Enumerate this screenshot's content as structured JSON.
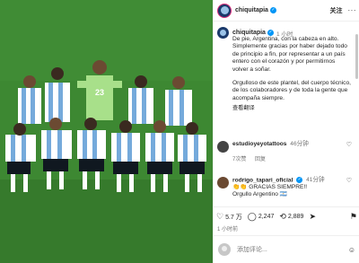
{
  "post": {
    "username": "chiquitapia",
    "follow_label": "关注",
    "more_label": "···",
    "time": "1 小时",
    "caption_p1": "De pie, Argentina, con la cabeza en alto. Simplemente gracias por haber dejado todo de principio a fin, por representar a un país entero con el corazón y por permitirnos volver a soñar.",
    "caption_p2": "Orgulloso de este plantel, del cuerpo técnico, de los colaboradores y de toda la gente que acompaña siempre.",
    "translate_label": "查看翻译",
    "posted_time": "1 小时前"
  },
  "comments": [
    {
      "username": "estudioyeyotattoos",
      "time": "46分钟",
      "text": "",
      "meta_likes": "7次赞",
      "reply_label": "回复"
    },
    {
      "username": "rodrigo_tapari_oficial",
      "time": "41分钟",
      "text": "GRACIAS SIEMPRE!!",
      "text2": "Orgullo Argentino",
      "emoji": "👏👏",
      "emoji2": "🇦🇷"
    }
  ],
  "actions": {
    "likes": "5.7 万",
    "comments": "2,247",
    "shares": "2,889"
  },
  "compose": {
    "placeholder": "添加评论..."
  },
  "photo": {
    "jersey_number": "23",
    "colors": {
      "grass": "#3b8430",
      "goalkeeper": "#a8e08a",
      "argentina_blue": "#75aadb"
    }
  },
  "theme": {
    "accent": "#0095f6",
    "story_ring": "#d62976",
    "muted": "#737373"
  }
}
